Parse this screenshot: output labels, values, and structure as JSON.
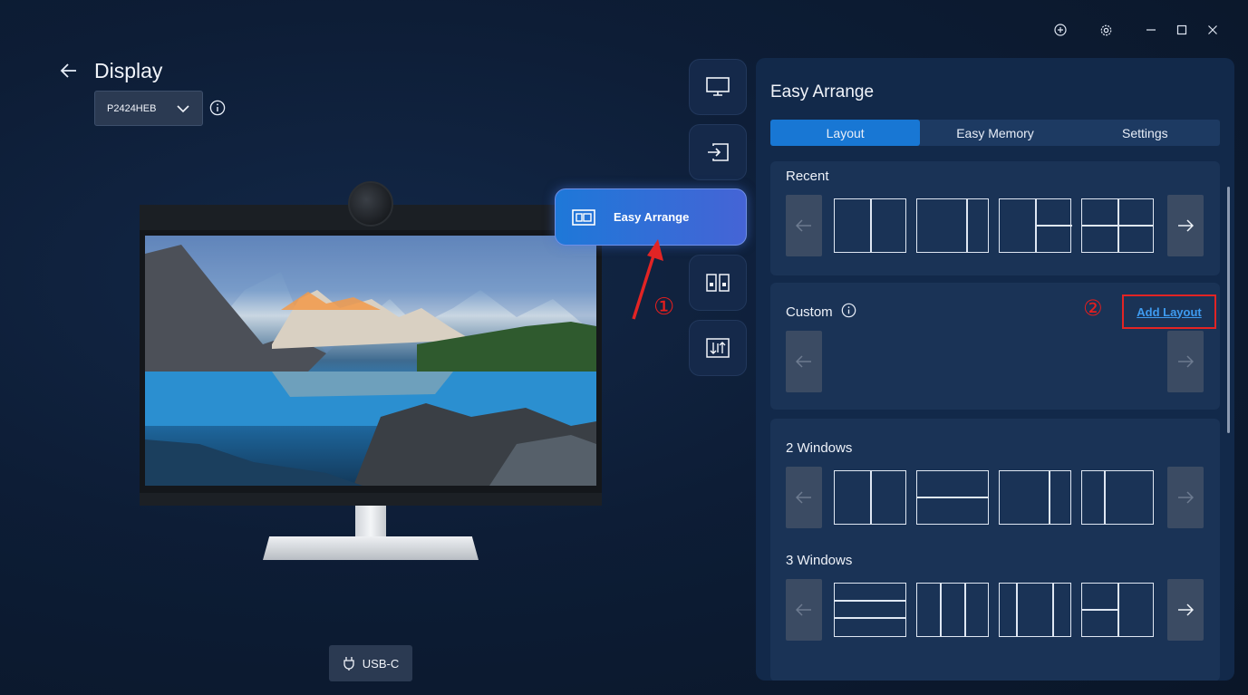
{
  "window": {
    "controls": [
      "add-icon",
      "settings-icon",
      "minimize-icon",
      "maximize-icon",
      "close-icon"
    ]
  },
  "header": {
    "title": "Display",
    "monitor_select": "P2424HEB"
  },
  "port": {
    "label": "USB-C"
  },
  "tools": {
    "active_label": "Easy Arrange",
    "items": [
      "monitor-icon",
      "input-source-icon",
      "easy-arrange-icon",
      "kvm-icon",
      "adjust-icon"
    ]
  },
  "annotations": {
    "one": "①",
    "two": "②"
  },
  "panel": {
    "title": "Easy Arrange",
    "tabs": [
      "Layout",
      "Easy Memory",
      "Settings"
    ],
    "selected_tab": "Layout",
    "recent_title": "Recent",
    "custom_title": "Custom",
    "add_layout": "Add Layout",
    "two_windows_title": "2 Windows",
    "three_windows_title": "3 Windows"
  },
  "colors": {
    "accent": "#1877d4",
    "annotation_red": "#e22424",
    "link": "#3e9bf0"
  }
}
